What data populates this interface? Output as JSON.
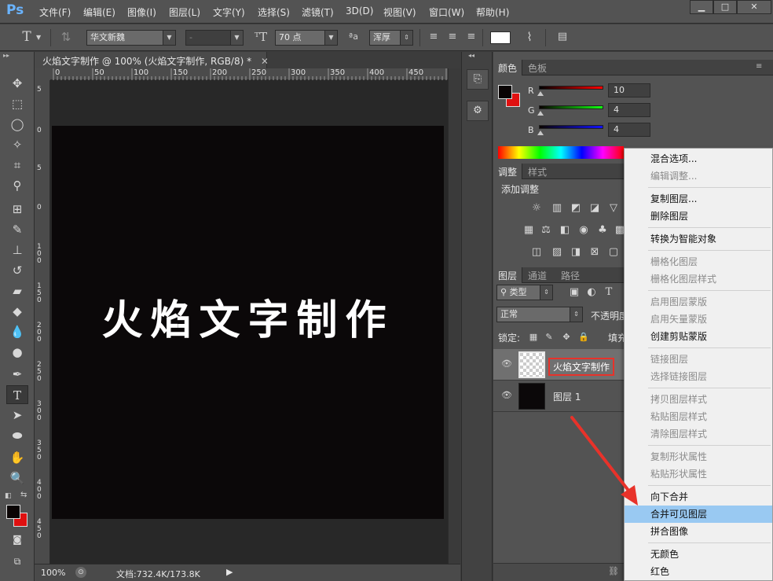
{
  "app": {
    "logo": "Ps",
    "menu": [
      "文件(F)",
      "编辑(E)",
      "图像(I)",
      "图层(L)",
      "文字(Y)",
      "选择(S)",
      "滤镜(T)",
      "3D(D)",
      "视图(V)",
      "窗口(W)",
      "帮助(H)"
    ],
    "window_buttons": [
      "▁",
      "□",
      "✕"
    ]
  },
  "options_bar": {
    "font_family": "华文新魏",
    "font_style": "-",
    "font_size": "70 点",
    "aa_label": "ªa",
    "aa_mode": "浑厚"
  },
  "document": {
    "tab_title": "火焰文字制作 @ 100% (火焰文字制作, RGB/8) *",
    "ruler_h_labels": [
      "0",
      "50",
      "100",
      "150",
      "200",
      "250",
      "300",
      "350",
      "400",
      "450"
    ],
    "ruler_v_labels": [
      "5",
      "0",
      "5",
      "0",
      "1 0 0",
      "1 5 0",
      "2 0 0",
      "2 5 0",
      "3 0 0",
      "3 5 0",
      "4 0 0",
      "4 5 0"
    ],
    "canvas_text": "火焰文字制作",
    "zoom": "100%",
    "doc_info": "文档:732.4K/173.8K"
  },
  "color_panel": {
    "tabs": [
      "颜色",
      "色板"
    ],
    "channels": [
      {
        "label": "R",
        "value": "10",
        "color": "#e01b1b"
      },
      {
        "label": "G",
        "value": "4",
        "color": "#1bb51b"
      },
      {
        "label": "B",
        "value": "4",
        "color": "#1b2be0"
      }
    ],
    "fg_color": "#0a0404",
    "bg_color": "#e01010"
  },
  "adjust_panel": {
    "tabs": [
      "调整",
      "样式"
    ],
    "title": "添加调整"
  },
  "layers_panel": {
    "tabs": [
      "图层",
      "通道",
      "路径"
    ],
    "filter": "类型",
    "blend_mode": "正常",
    "opacity_label": "不透明度",
    "lock_label": "锁定:",
    "fill_label": "填充",
    "layers": [
      {
        "name": "火焰文字制作",
        "selected": true
      },
      {
        "name": "图层 1",
        "selected": false
      }
    ]
  },
  "context_menu": {
    "items": [
      {
        "label": "混合选项...",
        "disabled": false
      },
      {
        "label": "编辑调整...",
        "disabled": true
      },
      {
        "sep": true
      },
      {
        "label": "复制图层...",
        "disabled": false
      },
      {
        "label": "删除图层",
        "disabled": false
      },
      {
        "sep": true
      },
      {
        "label": "转换为智能对象",
        "disabled": false
      },
      {
        "sep": true
      },
      {
        "label": "栅格化图层",
        "disabled": true
      },
      {
        "label": "栅格化图层样式",
        "disabled": true
      },
      {
        "sep": true
      },
      {
        "label": "启用图层蒙版",
        "disabled": true
      },
      {
        "label": "启用矢量蒙版",
        "disabled": true
      },
      {
        "label": "创建剪贴蒙版",
        "disabled": false
      },
      {
        "sep": true
      },
      {
        "label": "链接图层",
        "disabled": true
      },
      {
        "label": "选择链接图层",
        "disabled": true
      },
      {
        "sep": true
      },
      {
        "label": "拷贝图层样式",
        "disabled": true
      },
      {
        "label": "粘贴图层样式",
        "disabled": true
      },
      {
        "label": "清除图层样式",
        "disabled": true
      },
      {
        "sep": true
      },
      {
        "label": "复制形状属性",
        "disabled": true
      },
      {
        "label": "粘贴形状属性",
        "disabled": true
      },
      {
        "sep": true
      },
      {
        "label": "向下合并",
        "disabled": false
      },
      {
        "label": "合并可见图层",
        "disabled": false,
        "highlighted": true
      },
      {
        "label": "拼合图像",
        "disabled": false
      },
      {
        "sep": true
      },
      {
        "label": "无颜色",
        "disabled": false
      },
      {
        "label": "红色",
        "disabled": false
      }
    ]
  },
  "accent": {
    "highlight": "#99c9f2",
    "annotation_red": "#e8322a"
  }
}
